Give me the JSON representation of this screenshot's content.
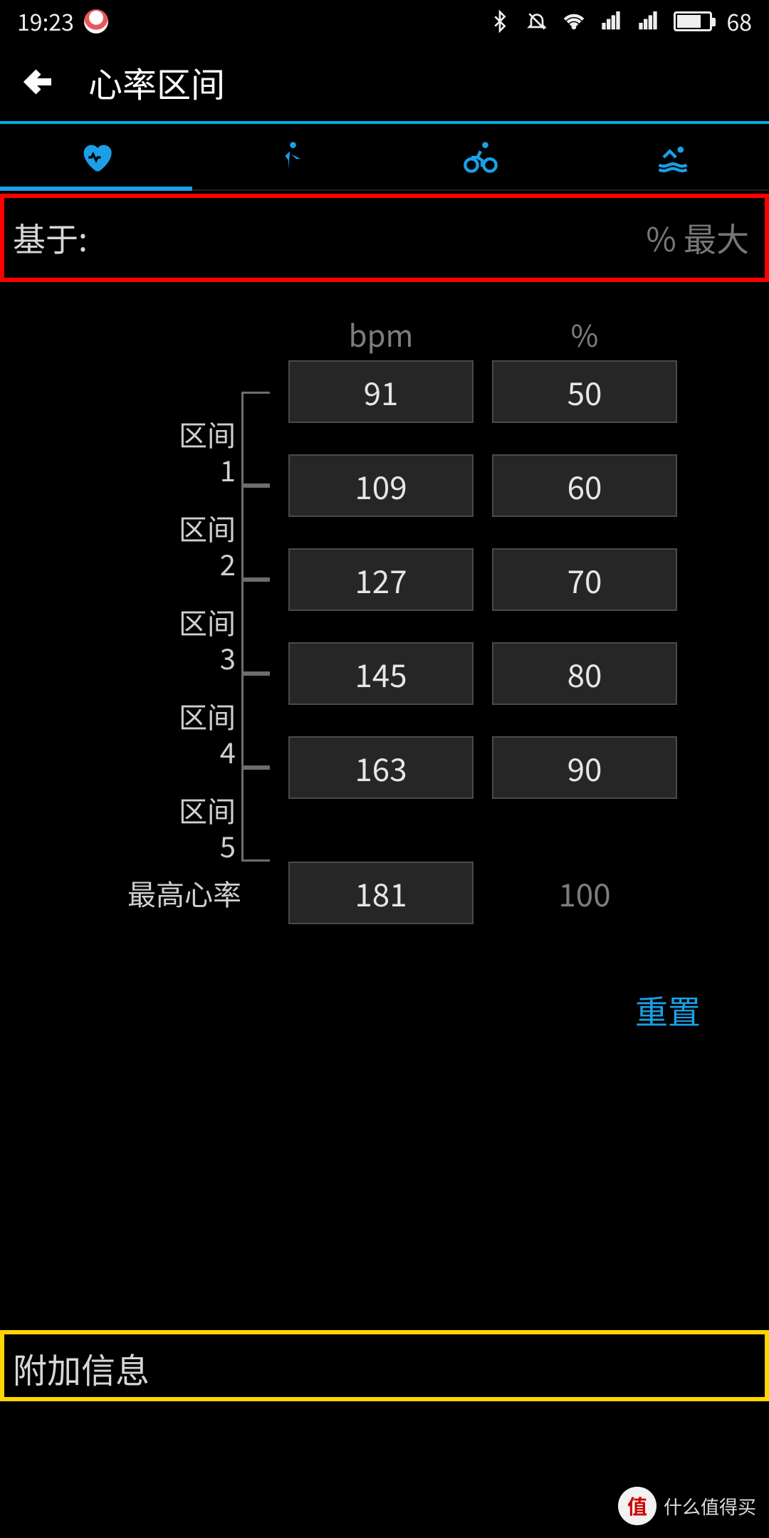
{
  "status": {
    "time": "19:23",
    "battery": "68"
  },
  "header": {
    "title": "心率区间"
  },
  "based_on": {
    "label": "基于:",
    "value": "% 最大"
  },
  "columns": {
    "bpm": "bpm",
    "pct": "%"
  },
  "zones": {
    "prefix": "区间",
    "labels": [
      "1",
      "2",
      "3",
      "4",
      "5"
    ],
    "max_label": "最高心率",
    "bpm": [
      "91",
      "109",
      "127",
      "145",
      "163",
      "181"
    ],
    "pct": [
      "50",
      "60",
      "70",
      "80",
      "90",
      "100"
    ]
  },
  "actions": {
    "reset": "重置"
  },
  "additional": {
    "label": "附加信息"
  },
  "watermark": {
    "char": "值",
    "text": "什么值得买"
  }
}
